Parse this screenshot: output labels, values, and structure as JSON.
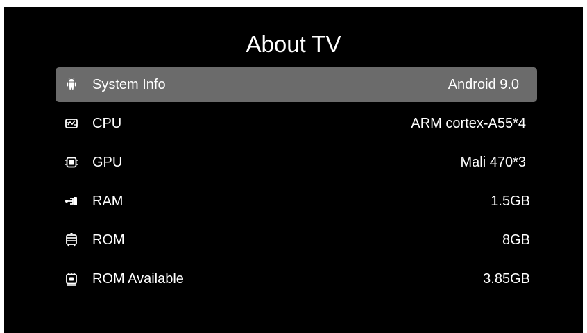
{
  "page": {
    "title": "About TV"
  },
  "colors": {
    "background": "#000000",
    "selected_row": "#6b6b6b",
    "text": "#ffffff"
  },
  "items": [
    {
      "icon": "android-icon",
      "label": "System Info",
      "value": "Android 9.0",
      "selected": true
    },
    {
      "icon": "cpu-icon",
      "label": "CPU",
      "value": "ARM cortex-A55*4",
      "selected": false
    },
    {
      "icon": "gpu-chip-icon",
      "label": "GPU",
      "value": "Mali 470*3",
      "selected": false
    },
    {
      "icon": "ram-icon",
      "label": "RAM",
      "value": "1.5GB",
      "selected": false
    },
    {
      "icon": "rom-icon",
      "label": "ROM",
      "value": "8GB",
      "selected": false
    },
    {
      "icon": "rom-available-icon",
      "label": "ROM Available",
      "value": "3.85GB",
      "selected": false
    }
  ]
}
